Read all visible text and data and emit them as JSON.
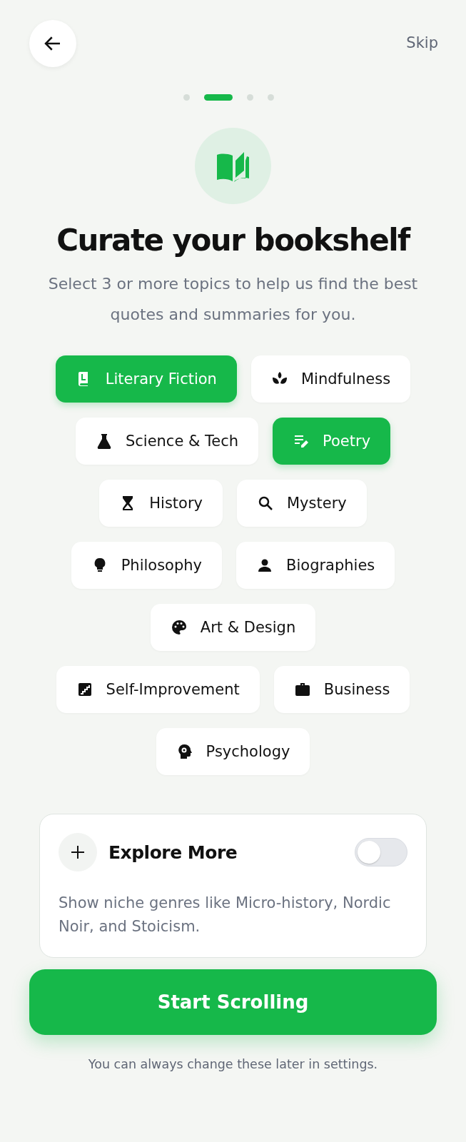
{
  "header": {
    "skip": "Skip"
  },
  "steps": [
    {
      "selected": false
    },
    {
      "selected": true
    },
    {
      "selected": false
    },
    {
      "selected": false
    }
  ],
  "title": "Curate your bookshelf",
  "subtitle": "Select 3 or more topics to help us find the best quotes and summaries for you.",
  "topic_rows": [
    [
      {
        "label": "Literary Fiction",
        "selected": true
      },
      {
        "label": "Mindfulness",
        "selected": false
      }
    ],
    [
      {
        "label": "Science & Tech",
        "selected": false
      },
      {
        "label": "Poetry",
        "selected": true
      }
    ],
    [
      {
        "label": "History",
        "selected": false
      },
      {
        "label": "Mystery",
        "selected": false
      }
    ],
    [
      {
        "label": "Philosophy",
        "selected": false
      },
      {
        "label": "Biographies",
        "selected": false
      }
    ],
    [
      {
        "label": "Art & Design",
        "selected": false
      }
    ],
    [
      {
        "label": "Self-Improvement",
        "selected": false
      },
      {
        "label": "Business",
        "selected": false
      }
    ],
    [
      {
        "label": "Psychology",
        "selected": false
      }
    ]
  ],
  "explore_more": {
    "title": "Explore More",
    "on": false,
    "description": "Show niche genres like Micro-history, Nordic Noir, and Stoicism."
  },
  "primary_button": "Start Scrolling",
  "footer": "You can always change these later in settings."
}
